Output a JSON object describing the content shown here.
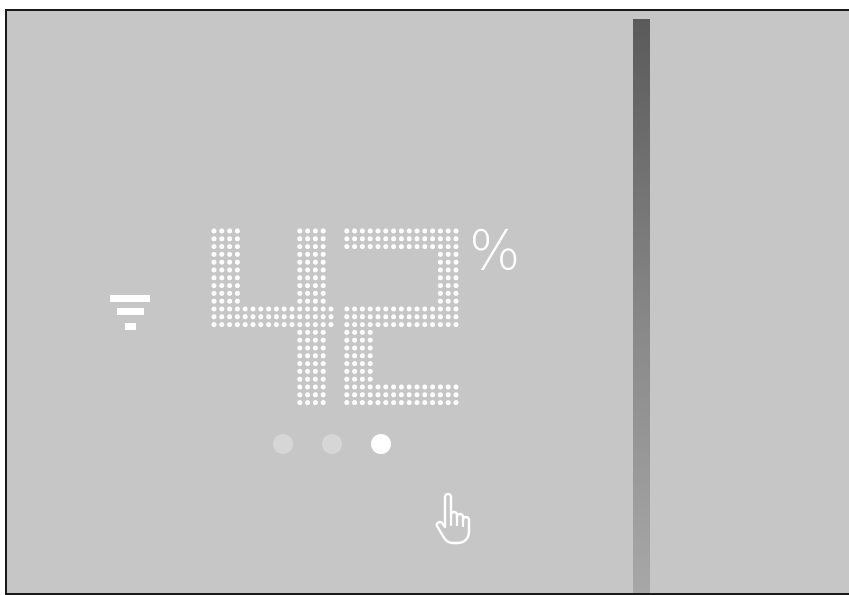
{
  "display": {
    "value": "42",
    "unit": "%",
    "filter_icon": "filter-icon",
    "gesture_icon": "hand-pointer-icon"
  },
  "pager": {
    "total": 3,
    "active_index": 2
  },
  "colors": {
    "screen_background": "#c6c6c6",
    "foreground": "#ffffff",
    "dot_inactive": "#d6d6d6",
    "divider": "#6a6a6a"
  }
}
